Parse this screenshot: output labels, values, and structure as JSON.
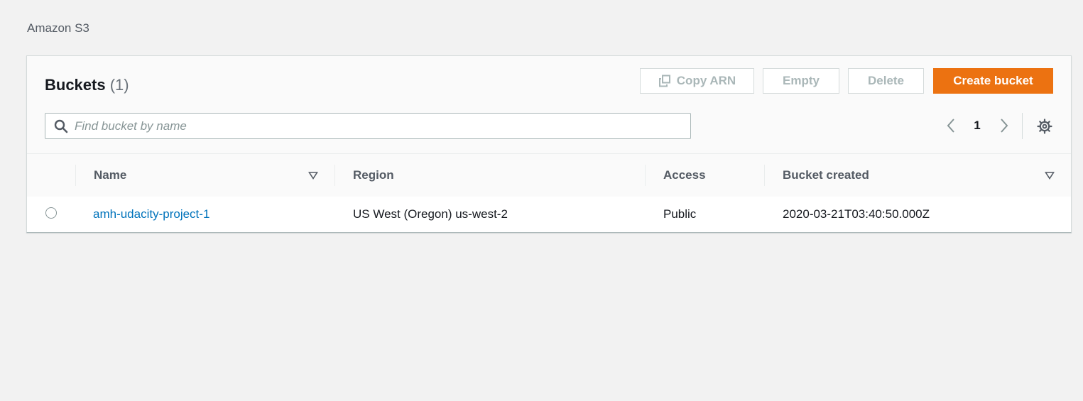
{
  "breadcrumb": {
    "label": "Amazon S3"
  },
  "panel": {
    "title": "Buckets",
    "count": "(1)"
  },
  "toolbar": {
    "copy_arn_label": "Copy ARN",
    "empty_label": "Empty",
    "delete_label": "Delete",
    "create_label": "Create bucket",
    "copy_icon": "copy-icon"
  },
  "search": {
    "placeholder": "Find bucket by name",
    "value": "",
    "icon": "search-icon"
  },
  "pagination": {
    "current_page": "1",
    "prev_icon": "chevron-left-icon",
    "next_icon": "chevron-right-icon",
    "settings_icon": "gear-icon"
  },
  "table": {
    "columns": [
      {
        "label": "Name",
        "sortable": true
      },
      {
        "label": "Region",
        "sortable": false
      },
      {
        "label": "Access",
        "sortable": false
      },
      {
        "label": "Bucket created",
        "sortable": true
      }
    ],
    "rows": [
      {
        "name": "amh-udacity-project-1",
        "region": "US West (Oregon) us-west-2",
        "access": "Public",
        "created": "2020-03-21T03:40:50.000Z",
        "selected": false
      }
    ]
  },
  "colors": {
    "accent": "#ec7211",
    "link": "#0073bb",
    "background": "#f2f2f2",
    "panel": "#fafafa",
    "disabled_text": "#aab7b8"
  }
}
